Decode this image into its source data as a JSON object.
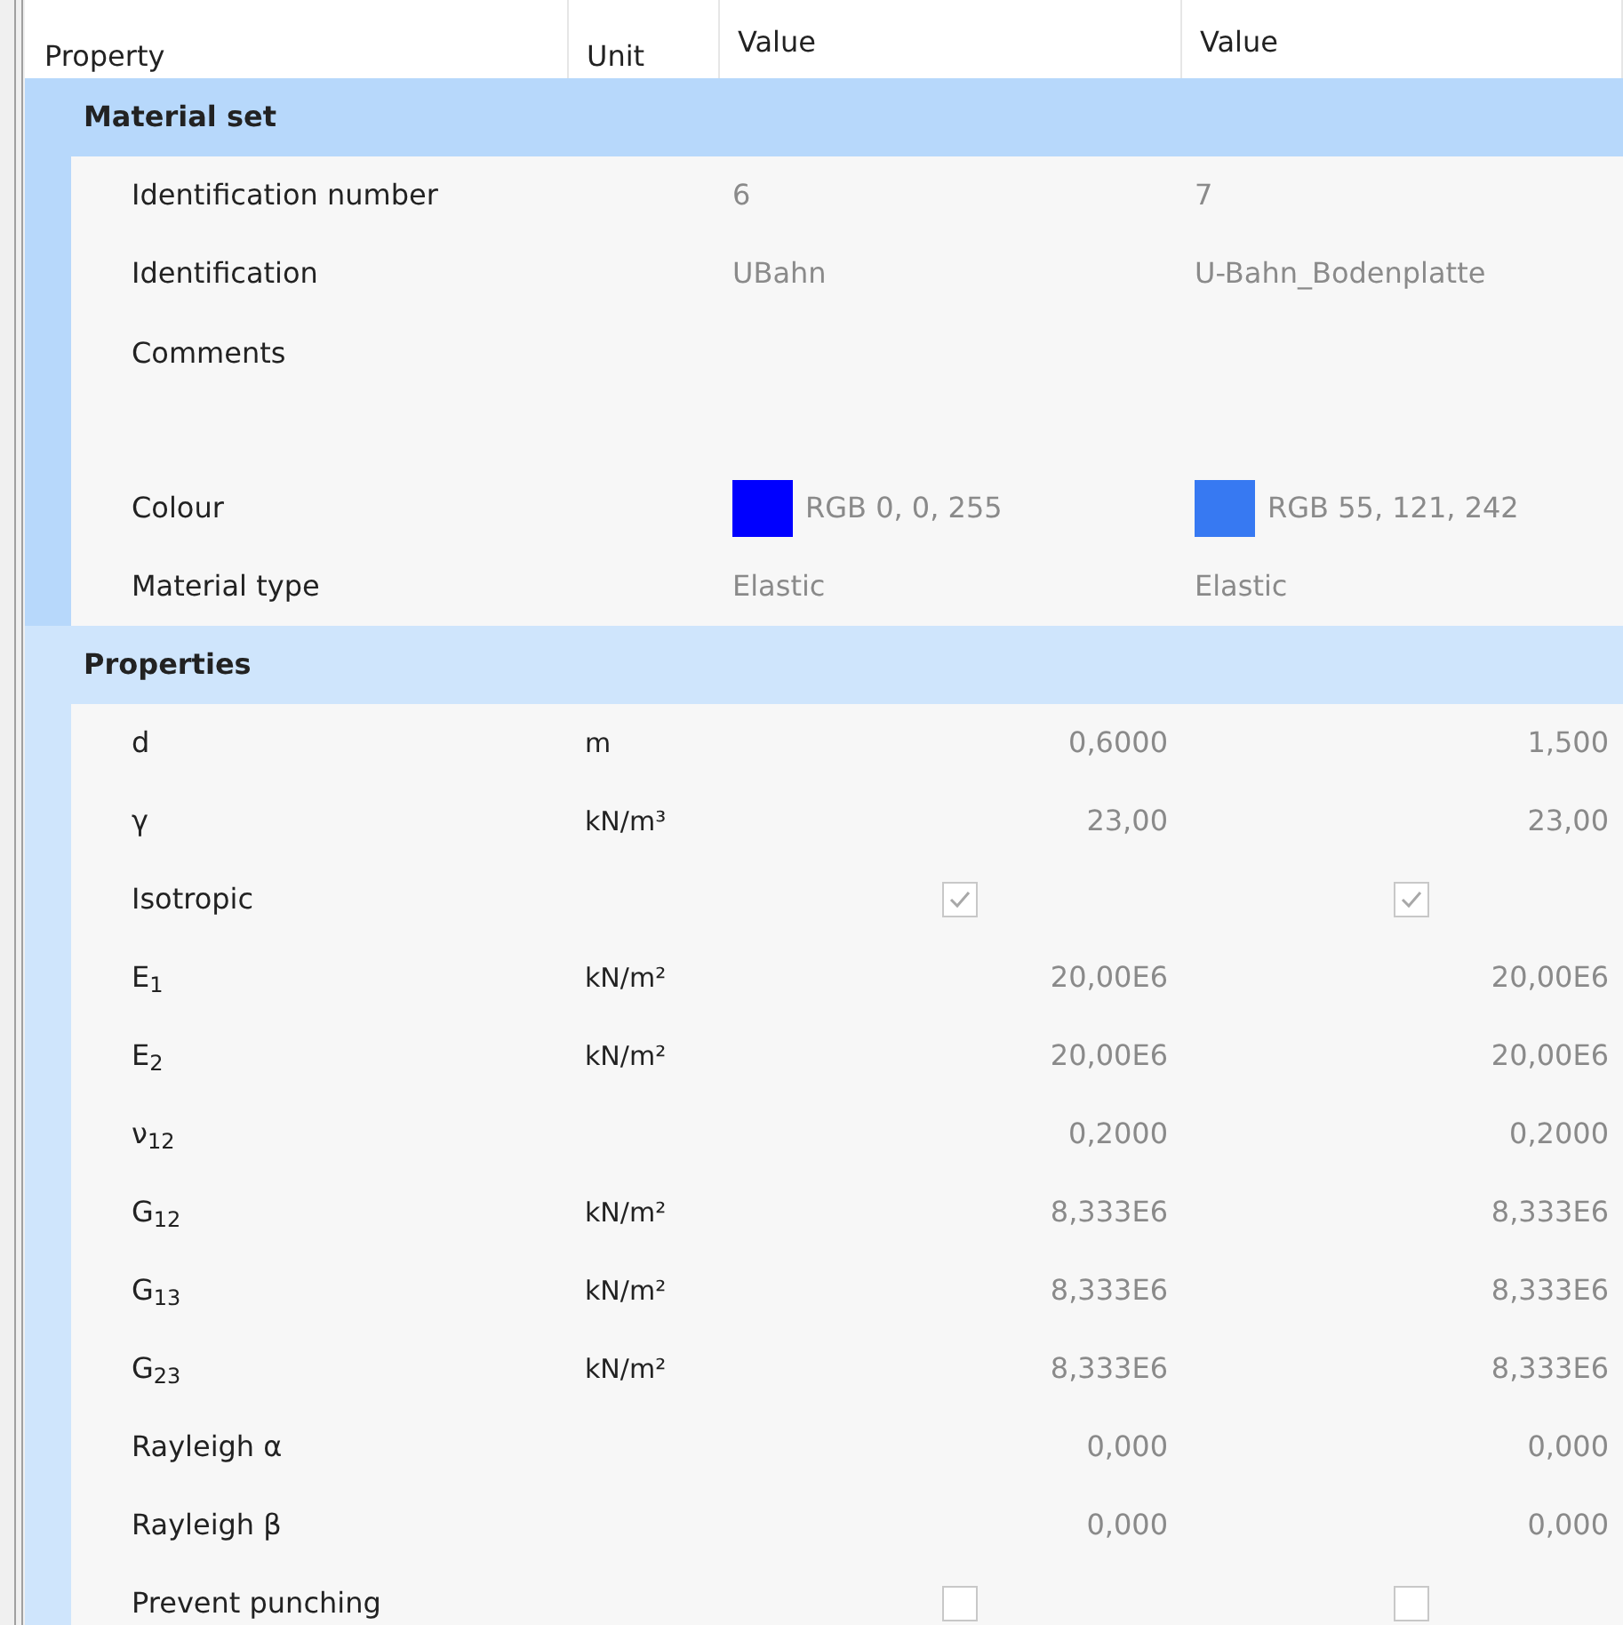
{
  "columns": [
    "Property",
    "Unit",
    "Value",
    "Value"
  ],
  "groups": [
    {
      "title": "Material set",
      "selected": true,
      "rows": [
        {
          "name": "Identification number",
          "values": [
            {
              "kind": "text",
              "text": "6"
            },
            {
              "kind": "text",
              "text": "7"
            }
          ]
        },
        {
          "name": "Identification",
          "values": [
            {
              "kind": "text",
              "text": "UBahn"
            },
            {
              "kind": "text",
              "text": "U-Bahn_Bodenplatte"
            }
          ]
        },
        {
          "name": "Comments",
          "kind": "tall",
          "values": []
        },
        {
          "name": "Colour",
          "values": [
            {
              "kind": "colour",
              "color": "#0000ff",
              "text": "RGB 0, 0, 255"
            },
            {
              "kind": "colour",
              "color": "#3779f2",
              "text": "RGB 55, 121, 242"
            }
          ]
        },
        {
          "name": "Material type",
          "values": [
            {
              "kind": "text",
              "text": "Elastic"
            },
            {
              "kind": "text",
              "text": "Elastic"
            }
          ]
        }
      ]
    },
    {
      "title": "Properties",
      "selected": false,
      "rows": [
        {
          "name": "d",
          "unit": "m",
          "values": [
            {
              "kind": "number",
              "text": "0,6000"
            },
            {
              "kind": "number",
              "text": "1,500"
            }
          ]
        },
        {
          "name": "γ",
          "unit": "kN/m³",
          "values": [
            {
              "kind": "number",
              "text": "23,00"
            },
            {
              "kind": "number",
              "text": "23,00"
            }
          ]
        },
        {
          "name": "Isotropic",
          "values": [
            {
              "kind": "check",
              "checked": true
            },
            {
              "kind": "check",
              "checked": true
            }
          ]
        },
        {
          "name": "E$_{1}$",
          "unit": "kN/m²",
          "values": [
            {
              "kind": "number",
              "text": "20,00E6"
            },
            {
              "kind": "number",
              "text": "20,00E6"
            }
          ]
        },
        {
          "name": "E$_{2}$",
          "unit": "kN/m²",
          "values": [
            {
              "kind": "number",
              "text": "20,00E6"
            },
            {
              "kind": "number",
              "text": "20,00E6"
            }
          ]
        },
        {
          "name": "ν$_{12}$",
          "values": [
            {
              "kind": "number",
              "text": "0,2000"
            },
            {
              "kind": "number",
              "text": "0,2000"
            }
          ]
        },
        {
          "name": "G$_{12}$",
          "unit": "kN/m²",
          "values": [
            {
              "kind": "number",
              "text": "8,333E6"
            },
            {
              "kind": "number",
              "text": "8,333E6"
            }
          ]
        },
        {
          "name": "G$_{13}$",
          "unit": "kN/m²",
          "values": [
            {
              "kind": "number",
              "text": "8,333E6"
            },
            {
              "kind": "number",
              "text": "8,333E6"
            }
          ]
        },
        {
          "name": "G$_{23}$",
          "unit": "kN/m²",
          "values": [
            {
              "kind": "number",
              "text": "8,333E6"
            },
            {
              "kind": "number",
              "text": "8,333E6"
            }
          ]
        },
        {
          "name": "Rayleigh α",
          "values": [
            {
              "kind": "number",
              "text": "0,000"
            },
            {
              "kind": "number",
              "text": "0,000"
            }
          ]
        },
        {
          "name": "Rayleigh β",
          "values": [
            {
              "kind": "number",
              "text": "0,000"
            },
            {
              "kind": "number",
              "text": "0,000"
            }
          ]
        },
        {
          "name": "Prevent punching",
          "values": [
            {
              "kind": "check",
              "checked": false
            },
            {
              "kind": "check",
              "checked": false
            }
          ]
        }
      ]
    }
  ]
}
